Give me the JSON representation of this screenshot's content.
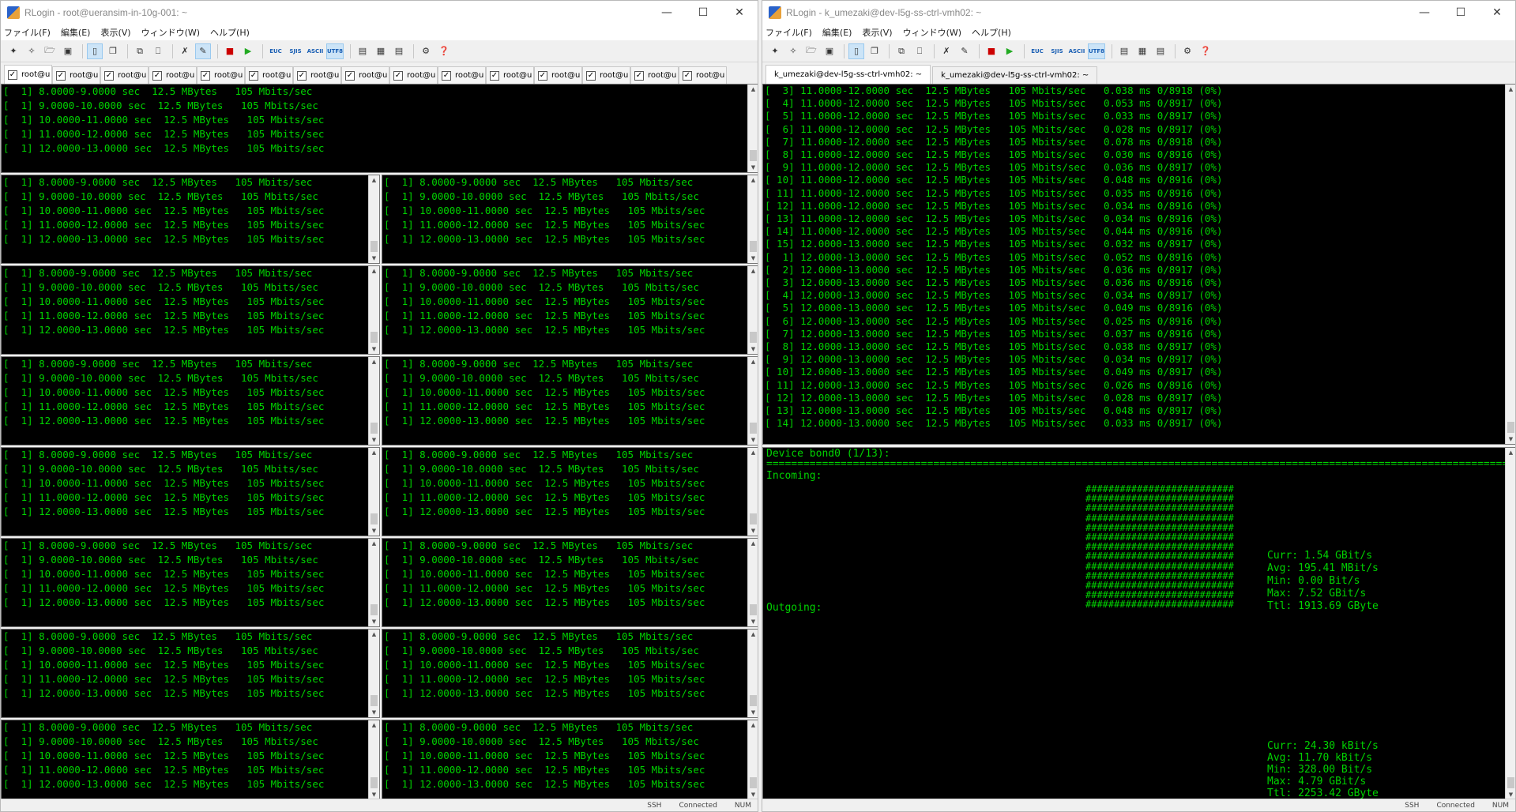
{
  "left": {
    "title": "RLogin - root@ueransim-in-10g-001: ~",
    "menu": [
      "ファイル(F)",
      "編集(E)",
      "表示(V)",
      "ウィンドウ(W)",
      "ヘルプ(H)"
    ],
    "tab_label": "root@u",
    "tab_count": 15,
    "pane_lines": [
      "[  1] 8.0000-9.0000 sec  12.5 MBytes   105 Mbits/sec",
      "[  1] 9.0000-10.0000 sec  12.5 MBytes   105 Mbits/sec",
      "[  1] 10.0000-11.0000 sec  12.5 MBytes   105 Mbits/sec",
      "[  1] 11.0000-12.0000 sec  12.5 MBytes   105 Mbits/sec",
      "[  1] 12.0000-13.0000 sec  12.5 MBytes   105 Mbits/sec"
    ],
    "status": [
      "SSH",
      "Connected",
      "NUM"
    ]
  },
  "right": {
    "title": "RLogin - k_umezaki@dev-l5g-ss-ctrl-vmh02: ~",
    "menu": [
      "ファイル(F)",
      "編集(E)",
      "表示(V)",
      "ウィンドウ(W)",
      "ヘルプ(H)"
    ],
    "tabs": [
      "k_umezaki@dev-l5g-ss-ctrl-vmh02: ~",
      "k_umezaki@dev-l5g-ss-ctrl-vmh02: ~"
    ],
    "iperf_lines": [
      "[  3] 11.0000-12.0000 sec  12.5 MBytes   105 Mbits/sec   0.038 ms 0/8918 (0%)",
      "[  4] 11.0000-12.0000 sec  12.5 MBytes   105 Mbits/sec   0.053 ms 0/8917 (0%)",
      "[  5] 11.0000-12.0000 sec  12.5 MBytes   105 Mbits/sec   0.033 ms 0/8917 (0%)",
      "[  6] 11.0000-12.0000 sec  12.5 MBytes   105 Mbits/sec   0.028 ms 0/8917 (0%)",
      "[  7] 11.0000-12.0000 sec  12.5 MBytes   105 Mbits/sec   0.078 ms 0/8918 (0%)",
      "[  8] 11.0000-12.0000 sec  12.5 MBytes   105 Mbits/sec   0.030 ms 0/8916 (0%)",
      "[  9] 11.0000-12.0000 sec  12.5 MBytes   105 Mbits/sec   0.036 ms 0/8917 (0%)",
      "[ 10] 11.0000-12.0000 sec  12.5 MBytes   105 Mbits/sec   0.048 ms 0/8916 (0%)",
      "[ 11] 11.0000-12.0000 sec  12.5 MBytes   105 Mbits/sec   0.035 ms 0/8916 (0%)",
      "[ 12] 11.0000-12.0000 sec  12.5 MBytes   105 Mbits/sec   0.034 ms 0/8916 (0%)",
      "[ 13] 11.0000-12.0000 sec  12.5 MBytes   105 Mbits/sec   0.034 ms 0/8916 (0%)",
      "[ 14] 11.0000-12.0000 sec  12.5 MBytes   105 Mbits/sec   0.044 ms 0/8916 (0%)",
      "[ 15] 12.0000-13.0000 sec  12.5 MBytes   105 Mbits/sec   0.032 ms 0/8917 (0%)",
      "[  1] 12.0000-13.0000 sec  12.5 MBytes   105 Mbits/sec   0.052 ms 0/8916 (0%)",
      "[  2] 12.0000-13.0000 sec  12.5 MBytes   105 Mbits/sec   0.036 ms 0/8917 (0%)",
      "[  3] 12.0000-13.0000 sec  12.5 MBytes   105 Mbits/sec   0.036 ms 0/8916 (0%)",
      "[  4] 12.0000-13.0000 sec  12.5 MBytes   105 Mbits/sec   0.034 ms 0/8917 (0%)",
      "[  5] 12.0000-13.0000 sec  12.5 MBytes   105 Mbits/sec   0.049 ms 0/8916 (0%)",
      "[  6] 12.0000-13.0000 sec  12.5 MBytes   105 Mbits/sec   0.025 ms 0/8916 (0%)",
      "[  7] 12.0000-13.0000 sec  12.5 MBytes   105 Mbits/sec   0.037 ms 0/8916 (0%)",
      "[  8] 12.0000-13.0000 sec  12.5 MBytes   105 Mbits/sec   0.038 ms 0/8917 (0%)",
      "[  9] 12.0000-13.0000 sec  12.5 MBytes   105 Mbits/sec   0.034 ms 0/8917 (0%)",
      "[ 10] 12.0000-13.0000 sec  12.5 MBytes   105 Mbits/sec   0.049 ms 0/8917 (0%)",
      "[ 11] 12.0000-13.0000 sec  12.5 MBytes   105 Mbits/sec   0.026 ms 0/8916 (0%)",
      "[ 12] 12.0000-13.0000 sec  12.5 MBytes   105 Mbits/sec   0.028 ms 0/8917 (0%)",
      "[ 13] 12.0000-13.0000 sec  12.5 MBytes   105 Mbits/sec   0.048 ms 0/8917 (0%)",
      "[ 14] 12.0000-13.0000 sec  12.5 MBytes   105 Mbits/sec   0.033 ms 0/8917 (0%)"
    ],
    "nload": {
      "header": "Device bond0 (1/13):",
      "incoming_label": "Incoming:",
      "outgoing_label": "Outgoing:",
      "bar_row": "##########################",
      "bar_rows": 13,
      "incoming_stats": [
        "Curr: 1.54 GBit/s",
        "Avg: 195.41 MBit/s",
        "Min: 0.00 Bit/s",
        "Max: 7.52 GBit/s",
        "Ttl: 1913.69 GByte"
      ],
      "outgoing_stats": [
        "Curr: 24.30 kBit/s",
        "Avg: 11.70 kBit/s",
        "Min: 328.00 Bit/s",
        "Max: 4.79 GBit/s",
        "Ttl: 2253.42 GByte"
      ]
    },
    "status": [
      "SSH",
      "Connected",
      "NUM"
    ]
  },
  "colors": {
    "terminal_bg": "#000000",
    "terminal_fg": "#00d200"
  }
}
